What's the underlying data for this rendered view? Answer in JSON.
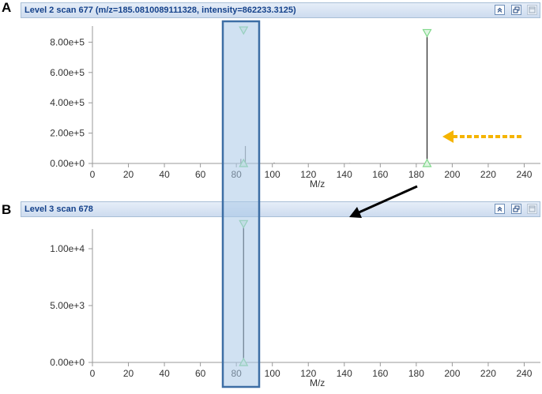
{
  "panels": [
    {
      "letter": "A",
      "title": "Level 2 scan 677 (m/z=185.0810089111328, intensity=862233.3125)"
    },
    {
      "letter": "B",
      "title": "Level 3 scan 678"
    }
  ],
  "toolbar_icons": [
    "collapse-icon",
    "restore-icon",
    "maximize-icon"
  ],
  "colors": {
    "titlebar_text": "#15428b",
    "marker": "#7fd88a",
    "highlight_fill": "#a9c8e8",
    "highlight_border": "#3d6ea5",
    "yellow_arrow": "#f5b400",
    "black_arrow": "#000000"
  },
  "chart_data": [
    {
      "type": "line",
      "xlabel": "M/z",
      "ylabel": "",
      "xlim": [
        0,
        250
      ],
      "ylim": [
        0,
        900000
      ],
      "xticks": [
        "0",
        "20",
        "40",
        "60",
        "80",
        "100",
        "120",
        "140",
        "160",
        "180",
        "200",
        "220",
        "240"
      ],
      "yticks": [
        "0.00e+0",
        "2.00e+5",
        "4.00e+5",
        "6.00e+5",
        "8.00e+5"
      ],
      "peaks": [
        {
          "mz": 82.5,
          "intensity": 30000
        },
        {
          "mz": 85.0,
          "intensity": 115000
        },
        {
          "mz": 101.0,
          "intensity": 6000
        },
        {
          "mz": 143.0,
          "intensity": 3000
        },
        {
          "mz": 186.0,
          "intensity": 862233
        }
      ],
      "markers": [
        {
          "mz": 84.0,
          "intensity": 880000,
          "dir": "down"
        },
        {
          "mz": 84.0,
          "intensity": 0,
          "dir": "up"
        },
        {
          "mz": 186.0,
          "intensity": 862233,
          "dir": "down"
        },
        {
          "mz": 186.0,
          "intensity": 0,
          "dir": "up"
        }
      ]
    },
    {
      "type": "line",
      "xlabel": "M/z",
      "ylabel": "",
      "xlim": [
        0,
        250
      ],
      "ylim": [
        0,
        12500
      ],
      "xticks": [
        "0",
        "20",
        "40",
        "60",
        "80",
        "100",
        "120",
        "140",
        "160",
        "180",
        "200",
        "220",
        "240"
      ],
      "yticks": [
        "0.00e+0",
        "5.00e+3",
        "1.00e+4"
      ],
      "ytick_values": [
        0,
        5000,
        10000
      ],
      "peaks": [
        {
          "mz": 84.0,
          "intensity": 12200
        }
      ],
      "markers": [
        {
          "mz": 84.0,
          "intensity": 12200,
          "dir": "down"
        },
        {
          "mz": 84.0,
          "intensity": 0,
          "dir": "up"
        }
      ]
    }
  ]
}
